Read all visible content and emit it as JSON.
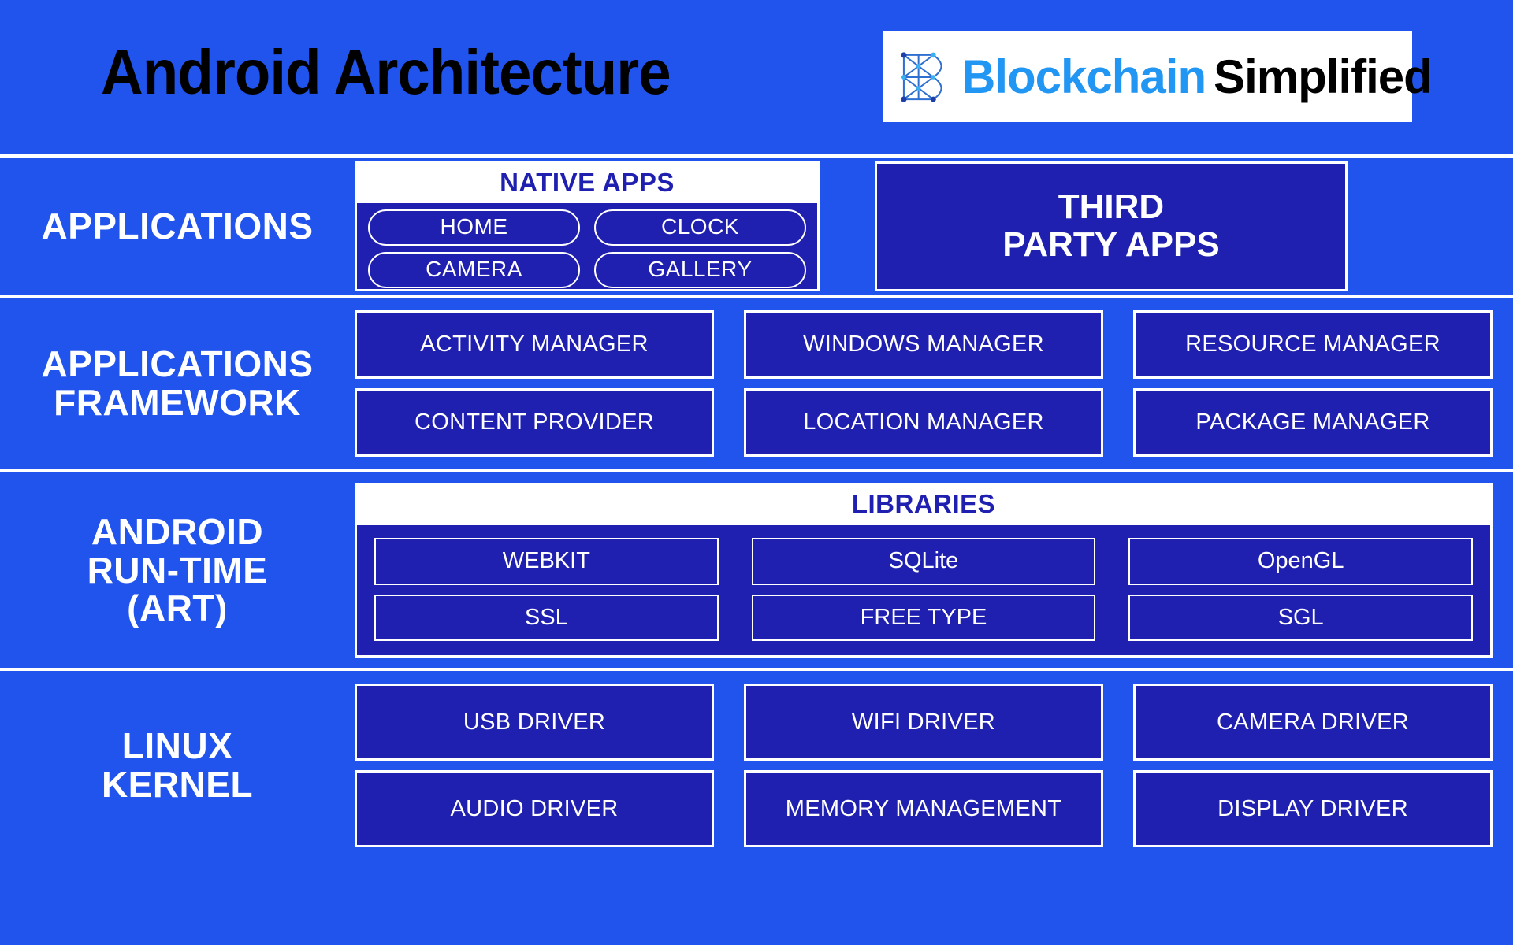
{
  "header": {
    "title": "Android Architecture",
    "logo": {
      "icon": "blockchain-b-node-icon",
      "word1": "Blockchain",
      "word2": "Simplified",
      "word1_color": "#2196f3",
      "word2_color": "#000000"
    }
  },
  "colors": {
    "background_blue": "#2154ec",
    "box_dark_blue": "#2020b0",
    "border_white": "#ffffff",
    "caption_text_blue": "#2020b0"
  },
  "layers": [
    {
      "id": "applications",
      "label": "APPLICATIONS",
      "native_panel": {
        "caption": "NATIVE APPS",
        "rows": [
          [
            "HOME",
            "CLOCK"
          ],
          [
            "CAMERA",
            "GALLERY"
          ]
        ]
      },
      "third_party": {
        "line1": "THIRD",
        "line2": "PARTY APPS"
      }
    },
    {
      "id": "applications-framework",
      "label_line1": "APPLICATIONS",
      "label_line2": "FRAMEWORK",
      "boxes": [
        "ACTIVITY MANAGER",
        "WINDOWS MANAGER",
        "RESOURCE MANAGER",
        "CONTENT PROVIDER",
        "LOCATION MANAGER",
        "PACKAGE MANAGER"
      ]
    },
    {
      "id": "android-runtime",
      "label_line1": "ANDROID",
      "label_line2": "RUN-TIME",
      "label_line3": "(ART)",
      "libraries": {
        "caption": "LIBRARIES",
        "boxes": [
          "WEBKIT",
          "SQLite",
          "OpenGL",
          "SSL",
          "FREE TYPE",
          "SGL"
        ]
      }
    },
    {
      "id": "linux-kernel",
      "label_line1": "LINUX",
      "label_line2": "KERNEL",
      "boxes": [
        "USB DRIVER",
        "WIFI DRIVER",
        "CAMERA DRIVER",
        "AUDIO DRIVER",
        "MEMORY MANAGEMENT",
        "DISPLAY DRIVER"
      ]
    }
  ]
}
